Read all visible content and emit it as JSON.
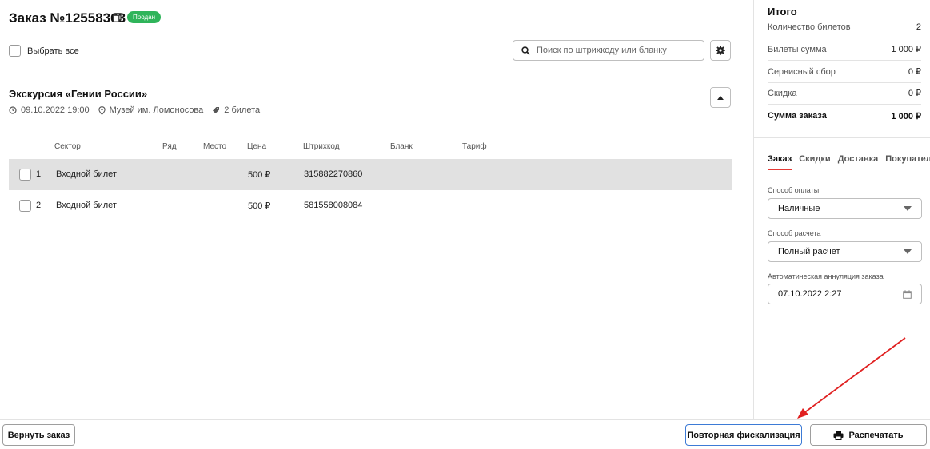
{
  "header": {
    "order_title": "Заказ №12558363",
    "status_badge": "Продан",
    "status_color": "#2fb45a"
  },
  "toolbar": {
    "select_all_label": "Выбрать все",
    "search_placeholder": "Поиск по штрихкоду или бланку",
    "search_icon": "search-icon",
    "settings_icon": "gear-icon"
  },
  "event": {
    "title": "Экскурсия «Гении России»",
    "datetime": "09.10.2022 19:00",
    "venue": "Музей им. Ломоносова",
    "tickets": "2 билета"
  },
  "table": {
    "headers": [
      "Сектор",
      "Ряд",
      "Место",
      "Цена",
      "Штрихкод",
      "Бланк",
      "Тариф"
    ],
    "rows": [
      {
        "num": "1",
        "sector": "Входной билет",
        "row": "",
        "seat": "",
        "price": "500 ₽",
        "barcode": "315882270860",
        "blank": "",
        "tariff": ""
      },
      {
        "num": "2",
        "sector": "Входной билет",
        "row": "",
        "seat": "",
        "price": "500 ₽",
        "barcode": "581558008084",
        "blank": "",
        "tariff": ""
      }
    ]
  },
  "summary": {
    "title": "Итого",
    "rows": [
      {
        "label": "Количество билетов",
        "value": "2"
      },
      {
        "label": "Билеты сумма",
        "value": "1 000 ₽"
      },
      {
        "label": "Сервисный сбор",
        "value": "0 ₽"
      },
      {
        "label": "Скидка",
        "value": "0 ₽"
      },
      {
        "label": "Сумма заказа",
        "value": "1 000 ₽"
      }
    ]
  },
  "tabs": [
    {
      "label": "Заказ",
      "active": true
    },
    {
      "label": "Скидки",
      "active": false
    },
    {
      "label": "Доставка",
      "active": false
    },
    {
      "label": "Покупатель",
      "active": false
    }
  ],
  "form": {
    "payment_method_label": "Способ оплаты",
    "payment_method_value": "Наличные",
    "settlement_label": "Способ расчета",
    "settlement_value": "Полный расчет",
    "annulment_label": "Автоматическая аннуляция заказа",
    "annulment_value": "07.10.2022 2:27"
  },
  "footer": {
    "return_label": "Вернуть заказ",
    "refiscal_label": "Повторная фискализация",
    "print_label": "Распечатать"
  },
  "colors": {
    "accent_red": "#e53935",
    "primary_border": "#3d7bd6",
    "row_highlight": "#e1e1e1"
  }
}
